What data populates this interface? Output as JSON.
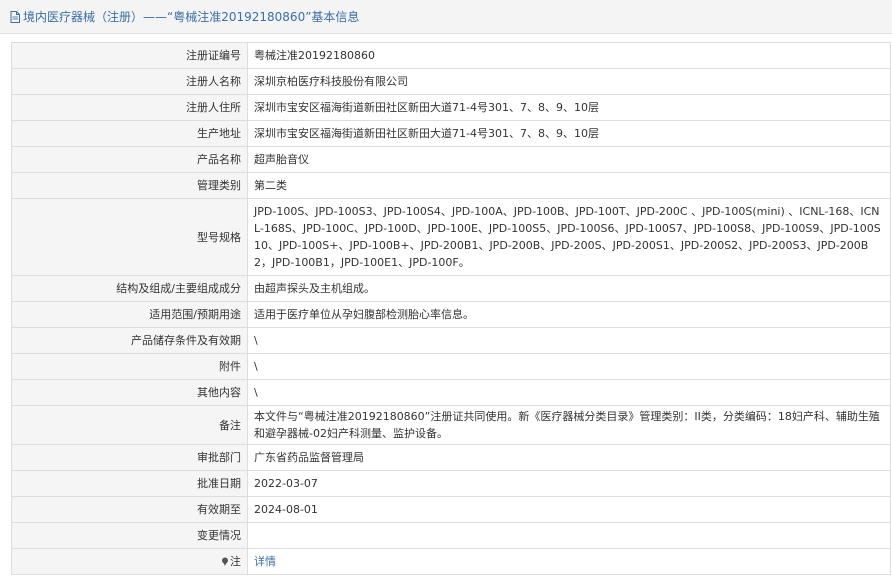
{
  "header": {
    "title": "境内医疗器械（注册）——“粤械注准20192180860”基本信息"
  },
  "rows": [
    {
      "label": "注册证编号",
      "value": "粤械注准20192180860"
    },
    {
      "label": "注册人名称",
      "value": "深圳京柏医疗科技股份有限公司"
    },
    {
      "label": "注册人住所",
      "value": "深圳市宝安区福海街道新田社区新田大道71-4号301、7、8、9、10层"
    },
    {
      "label": "生产地址",
      "value": "深圳市宝安区福海街道新田社区新田大道71-4号301、7、8、9、10层"
    },
    {
      "label": "产品名称",
      "value": "超声胎音仪"
    },
    {
      "label": "管理类别",
      "value": "第二类"
    },
    {
      "label": "型号规格",
      "value": "JPD-100S、JPD-100S3、JPD-100S4、JPD-100A、JPD-100B、JPD-100T、JPD-200C 、JPD-100S(mini) 、ICNL-168、ICNL-168S、JPD-100C、JPD-100D、JPD-100E、JPD-100S5、JPD-100S6、JPD-100S7、JPD-100S8、JPD-100S9、JPD-100S10、JPD-100S+、JPD-100B+、JPD-200B1、JPD-200B、JPD-200S、JPD-200S1、JPD-200S2、JPD-200S3、JPD-200B2，JPD-100B1，JPD-100E1、JPD-100F。"
    },
    {
      "label": "结构及组成/主要组成成分",
      "value": "由超声探头及主机组成。"
    },
    {
      "label": "适用范围/预期用途",
      "value": "适用于医疗单位从孕妇腹部检测胎心率信息。"
    },
    {
      "label": "产品储存条件及有效期",
      "value": "\\"
    },
    {
      "label": "附件",
      "value": "\\"
    },
    {
      "label": "其他内容",
      "value": "\\"
    },
    {
      "label": "备注",
      "value": "本文件与“粤械注准20192180860”注册证共同使用。新《医疗器械分类目录》管理类别：II类，分类编码：18妇产科、辅助生殖和避孕器械-02妇产科测量、监护设备。"
    },
    {
      "label": "审批部门",
      "value": "广东省药品监督管理局"
    },
    {
      "label": "批准日期",
      "value": "2022-03-07"
    },
    {
      "label": "有效期至",
      "value": "2024-08-01"
    },
    {
      "label": "变更情况",
      "value": ""
    },
    {
      "label": "注",
      "value": "详情"
    }
  ],
  "colors": {
    "link": "#3a6ea5",
    "label_bg": "#f5f5f5",
    "border": "#dddddd"
  },
  "icons": {
    "header": "document-icon",
    "note": "pin-icon"
  }
}
